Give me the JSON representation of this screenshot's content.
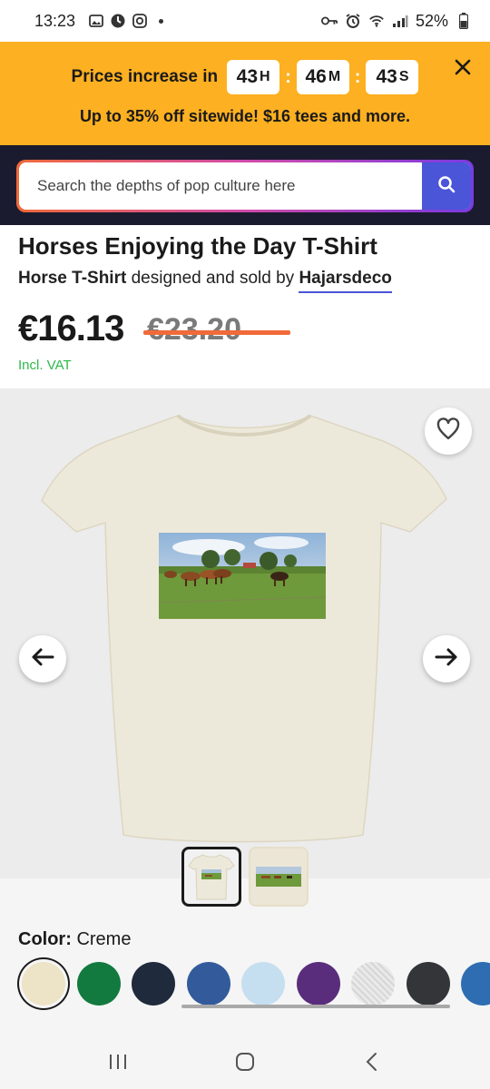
{
  "status_bar": {
    "time": "13:23",
    "battery": "52%"
  },
  "promo": {
    "lead_text": "Prices increase in",
    "timer": [
      {
        "value": "43",
        "unit": "H"
      },
      {
        "value": "46",
        "unit": "M"
      },
      {
        "value": "43",
        "unit": "S"
      }
    ],
    "separator": ":",
    "subtext": "Up to 35% off sitewide! $16 tees and more."
  },
  "search": {
    "placeholder": "Search the depths of pop culture here"
  },
  "product": {
    "title": "Horses Enjoying the Day T-Shirt",
    "category_link": "Horse T-Shirt",
    "byline_middle": " designed and sold by ",
    "designer": "Hajarsdeco",
    "price": "€16.13",
    "original_price": "€23.20",
    "vat_note": "Incl. VAT"
  },
  "color": {
    "label": "Color:",
    "selected": "Creme",
    "swatches": [
      {
        "name": "creme",
        "hex": "#ede3c7"
      },
      {
        "name": "green",
        "hex": "#127a3e"
      },
      {
        "name": "navy",
        "hex": "#1f2a3c"
      },
      {
        "name": "royal-blue",
        "hex": "#335b9c"
      },
      {
        "name": "light-blue",
        "hex": "#c5dff0"
      },
      {
        "name": "purple",
        "hex": "#5a2d7c"
      },
      {
        "name": "heather-gray",
        "hex": "#e2e2e2"
      },
      {
        "name": "charcoal",
        "hex": "#333538"
      },
      {
        "name": "blue-partial",
        "hex": "#2e6db2"
      }
    ]
  },
  "icons": {
    "close": "close-icon",
    "search": "search-icon",
    "wishlist": "heart-icon",
    "prev": "arrow-left-icon",
    "next": "arrow-right-icon",
    "nav_recent": "recent-apps-icon",
    "nav_home": "home-icon",
    "nav_back": "back-icon"
  },
  "colors": {
    "banner": "#fdb021",
    "search_bg": "#1b1b2f",
    "search_button": "#4a55d8",
    "strike": "#f06a3a",
    "vat": "#2eb84a"
  }
}
